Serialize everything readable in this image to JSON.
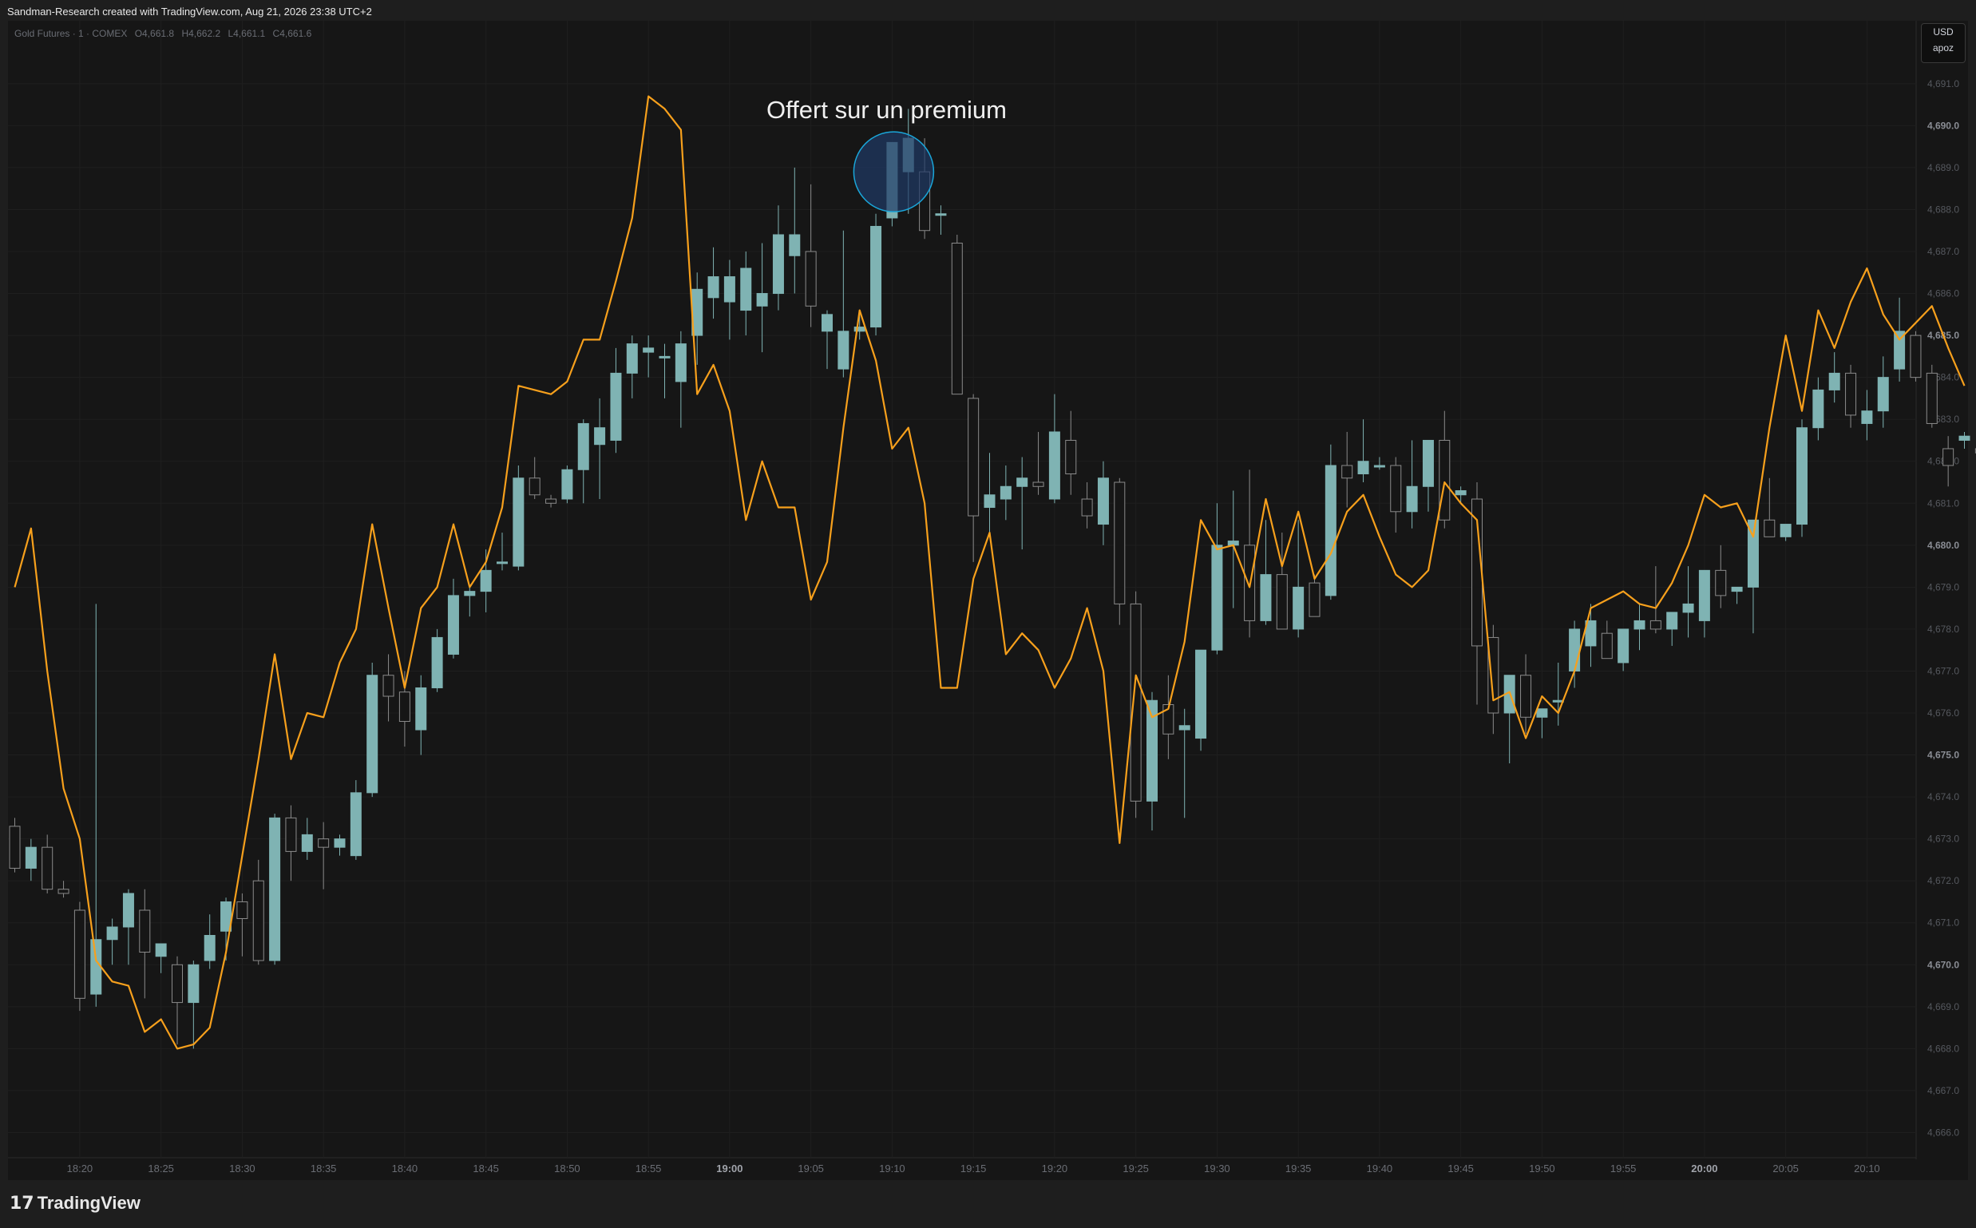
{
  "header": {
    "attribution": "Sandman-Research created with TradingView.com, Aug 21, 2026 23:38 UTC+2"
  },
  "legend": {
    "symbol": "Gold Futures · 1 · COMEX",
    "open": "O4,661.8",
    "high": "H4,662.2",
    "low": "L4,661.1",
    "close": "C4,661.6"
  },
  "currency": {
    "code": "USD",
    "label": "apoz"
  },
  "footer": {
    "brand": "TradingView"
  },
  "colors": {
    "background": "#161616",
    "candle_up": "#7fb3b3",
    "candle_down": "#161616",
    "wick": "#8a8a8a",
    "overlay_line": "#f7a01c",
    "highlight_fill": "#1f3a66",
    "highlight_stroke": "#1aa6d9"
  },
  "chart_data": {
    "type": "candlestick",
    "title": "Offert sur un premium",
    "ylim": [
      4665.4,
      4692.5
    ],
    "x_start": "18:16",
    "x_end": "20:14",
    "x_interval_minutes": 1,
    "ytick_labels": [
      "4,666.0",
      "4,667.0",
      "4,668.0",
      "4,669.0",
      "4,670.0",
      "4,671.0",
      "4,672.0",
      "4,673.0",
      "4,674.0",
      "4,675.0",
      "4,676.0",
      "4,677.0",
      "4,678.0",
      "4,679.0",
      "4,680.0",
      "4,681.0",
      "4,682.0",
      "4,683.0",
      "4,684.0",
      "4,685.0",
      "4,686.0",
      "4,687.0",
      "4,688.0",
      "4,689.0",
      "4,690.0",
      "4,691.0"
    ],
    "ytick_values": [
      4666,
      4667,
      4668,
      4669,
      4670,
      4671,
      4672,
      4673,
      4674,
      4675,
      4676,
      4677,
      4678,
      4679,
      4680,
      4681,
      4682,
      4683,
      4684,
      4685,
      4686,
      4687,
      4688,
      4689,
      4690,
      4691
    ],
    "xtick_labels": [
      "18:20",
      "18:25",
      "18:30",
      "18:35",
      "18:40",
      "18:45",
      "18:50",
      "18:55",
      "19:00",
      "19:05",
      "19:10",
      "19:15",
      "19:20",
      "19:25",
      "19:30",
      "19:35",
      "19:40",
      "19:45",
      "19:50",
      "19:55",
      "20:00",
      "20:05",
      "20:10"
    ],
    "xtick_minutes": [
      4,
      9,
      14,
      19,
      24,
      29,
      34,
      39,
      44,
      49,
      54,
      59,
      64,
      69,
      74,
      79,
      84,
      89,
      94,
      99,
      104,
      109,
      114
    ],
    "bold_xticks": [
      "19:00",
      "20:00"
    ],
    "ohlc": [
      [
        4673.3,
        4673.5,
        4672.2,
        4672.3
      ],
      [
        4672.3,
        4673.0,
        4672.0,
        4672.8
      ],
      [
        4672.8,
        4673.1,
        4671.7,
        4671.8
      ],
      [
        4671.8,
        4672.0,
        4671.6,
        4671.7
      ],
      [
        4671.3,
        4671.5,
        4668.9,
        4669.2
      ],
      [
        4669.3,
        4678.6,
        4669.0,
        4670.6
      ],
      [
        4670.6,
        4671.1,
        4670.0,
        4670.9
      ],
      [
        4670.9,
        4671.8,
        4670.0,
        4671.7
      ],
      [
        4671.3,
        4671.8,
        4669.2,
        4670.3
      ],
      [
        4670.2,
        4670.5,
        4669.8,
        4670.5
      ],
      [
        4670.0,
        4670.2,
        4668.1,
        4669.1
      ],
      [
        4669.1,
        4670.1,
        4668.0,
        4670.0
      ],
      [
        4670.1,
        4671.2,
        4669.9,
        4670.7
      ],
      [
        4670.8,
        4671.6,
        4670.1,
        4671.5
      ],
      [
        4671.5,
        4671.7,
        4670.2,
        4671.1
      ],
      [
        4672.0,
        4672.5,
        4670.0,
        4670.1
      ],
      [
        4670.1,
        4673.6,
        4670.0,
        4673.5
      ],
      [
        4673.5,
        4673.8,
        4672.0,
        4672.7
      ],
      [
        4672.7,
        4673.5,
        4672.5,
        4673.1
      ],
      [
        4673.0,
        4673.4,
        4671.8,
        4672.8
      ],
      [
        4672.8,
        4673.1,
        4672.6,
        4673.0
      ],
      [
        4672.6,
        4674.4,
        4672.5,
        4674.1
      ],
      [
        4674.1,
        4677.2,
        4674.0,
        4676.9
      ],
      [
        4676.9,
        4677.4,
        4675.8,
        4676.4
      ],
      [
        4676.5,
        4677.0,
        4675.2,
        4675.8
      ],
      [
        4675.6,
        4676.9,
        4675.0,
        4676.6
      ],
      [
        4676.6,
        4678.0,
        4676.5,
        4677.8
      ],
      [
        4677.4,
        4679.2,
        4677.3,
        4678.8
      ],
      [
        4678.8,
        4679.0,
        4678.3,
        4678.9
      ],
      [
        4678.9,
        4679.9,
        4678.4,
        4679.4
      ],
      [
        4679.6,
        4680.3,
        4679.4,
        4679.6
      ],
      [
        4679.5,
        4681.9,
        4679.4,
        4681.6
      ],
      [
        4681.6,
        4682.1,
        4681.1,
        4681.2
      ],
      [
        4681.1,
        4681.2,
        4680.9,
        4681.0
      ],
      [
        4681.1,
        4681.9,
        4681.0,
        4681.8
      ],
      [
        4681.8,
        4683.0,
        4681.0,
        4682.9
      ],
      [
        4682.4,
        4683.5,
        4681.1,
        4682.8
      ],
      [
        4682.5,
        4684.7,
        4682.2,
        4684.1
      ],
      [
        4684.1,
        4685.0,
        4683.5,
        4684.8
      ],
      [
        4684.6,
        4685.0,
        4684.0,
        4684.7
      ],
      [
        4684.5,
        4684.8,
        4683.5,
        4684.5
      ],
      [
        4683.9,
        4685.1,
        4682.8,
        4684.8
      ],
      [
        4685.0,
        4686.5,
        4684.3,
        4686.1
      ],
      [
        4685.9,
        4687.1,
        4685.4,
        4686.4
      ],
      [
        4685.8,
        4686.8,
        4684.9,
        4686.4
      ],
      [
        4685.6,
        4687.0,
        4685.0,
        4686.6
      ],
      [
        4685.7,
        4687.2,
        4684.6,
        4686.0
      ],
      [
        4686.0,
        4688.1,
        4685.6,
        4687.4
      ],
      [
        4686.9,
        4689.0,
        4686.0,
        4687.4
      ],
      [
        4687.0,
        4688.6,
        4685.2,
        4685.7
      ],
      [
        4685.1,
        4685.6,
        4684.2,
        4685.5
      ],
      [
        4684.2,
        4687.5,
        4684.0,
        4685.1
      ],
      [
        4685.1,
        4685.5,
        4684.9,
        4685.2
      ],
      [
        4685.2,
        4687.9,
        4685.0,
        4687.6
      ],
      [
        4687.8,
        4689.6,
        4687.6,
        4689.6
      ],
      [
        4688.9,
        4690.4,
        4687.9,
        4689.7
      ],
      [
        4688.9,
        4689.7,
        4687.3,
        4687.5
      ],
      [
        4687.9,
        4688.1,
        4687.4,
        4687.9
      ],
      [
        4687.2,
        4687.4,
        4683.6,
        4683.6
      ],
      [
        4683.5,
        4683.6,
        4679.6,
        4680.7
      ],
      [
        4680.9,
        4682.2,
        4680.2,
        4681.2
      ],
      [
        4681.1,
        4681.9,
        4680.6,
        4681.4
      ],
      [
        4681.4,
        4682.1,
        4679.9,
        4681.6
      ],
      [
        4681.5,
        4682.7,
        4681.2,
        4681.4
      ],
      [
        4681.1,
        4683.6,
        4681.0,
        4682.7
      ],
      [
        4682.5,
        4683.2,
        4681.2,
        4681.7
      ],
      [
        4681.1,
        4681.5,
        4680.4,
        4680.7
      ],
      [
        4680.5,
        4682.0,
        4680.0,
        4681.6
      ],
      [
        4681.5,
        4681.6,
        4678.1,
        4678.6
      ],
      [
        4678.6,
        4678.9,
        4673.5,
        4673.9
      ],
      [
        4673.9,
        4676.5,
        4673.2,
        4676.3
      ],
      [
        4676.2,
        4676.9,
        4674.9,
        4675.5
      ],
      [
        4675.6,
        4676.1,
        4673.5,
        4675.7
      ],
      [
        4675.4,
        4677.0,
        4675.1,
        4677.5
      ],
      [
        4677.5,
        4681.0,
        4677.4,
        4680.0
      ],
      [
        4680.0,
        4681.3,
        4678.5,
        4680.1
      ],
      [
        4680.0,
        4681.8,
        4677.8,
        4678.2
      ],
      [
        4678.2,
        4680.6,
        4678.1,
        4679.3
      ],
      [
        4679.3,
        4680.3,
        4678.5,
        4678.0
      ],
      [
        4678.0,
        4680.6,
        4677.8,
        4679.0
      ],
      [
        4679.1,
        4679.3,
        4678.4,
        4678.3
      ],
      [
        4678.8,
        4682.4,
        4678.7,
        4681.9
      ],
      [
        4681.9,
        4682.7,
        4680.9,
        4681.6
      ],
      [
        4681.7,
        4683.0,
        4681.5,
        4682.0
      ],
      [
        4681.9,
        4682.1,
        4681.8,
        4681.9
      ],
      [
        4681.9,
        4682.1,
        4680.3,
        4680.8
      ],
      [
        4680.8,
        4682.5,
        4680.4,
        4681.4
      ],
      [
        4681.4,
        4682.3,
        4680.8,
        4682.5
      ],
      [
        4682.5,
        4683.2,
        4680.4,
        4680.6
      ],
      [
        4681.2,
        4681.4,
        4681.0,
        4681.3
      ],
      [
        4681.1,
        4681.5,
        4676.2,
        4677.6
      ],
      [
        4677.8,
        4678.1,
        4675.5,
        4676.0
      ],
      [
        4676.0,
        4676.9,
        4674.8,
        4676.9
      ],
      [
        4676.9,
        4677.4,
        4675.5,
        4675.9
      ],
      [
        4675.9,
        4676.0,
        4675.4,
        4676.1
      ],
      [
        4676.3,
        4677.2,
        4675.7,
        4676.3
      ],
      [
        4677.0,
        4678.2,
        4676.6,
        4678.0
      ],
      [
        4677.6,
        4678.6,
        4677.1,
        4678.2
      ],
      [
        4677.9,
        4678.2,
        4677.6,
        4677.3
      ],
      [
        4677.2,
        4678.0,
        4677.0,
        4678.0
      ],
      [
        4678.0,
        4678.6,
        4677.5,
        4678.2
      ],
      [
        4678.2,
        4679.5,
        4677.9,
        4678.0
      ],
      [
        4678.0,
        4678.3,
        4677.6,
        4678.4
      ],
      [
        4678.4,
        4679.5,
        4677.8,
        4678.6
      ],
      [
        4678.2,
        4679.0,
        4677.8,
        4679.4
      ],
      [
        4679.4,
        4680.0,
        4678.5,
        4678.8
      ],
      [
        4678.9,
        4678.9,
        4678.6,
        4679.0
      ],
      [
        4679.0,
        4679.3,
        4677.9,
        4680.6
      ],
      [
        4680.6,
        4681.6,
        4680.2,
        4680.2
      ],
      [
        4680.2,
        4680.5,
        4680.1,
        4680.5
      ],
      [
        4680.5,
        4683.0,
        4680.2,
        4682.8
      ],
      [
        4682.8,
        4684.0,
        4682.5,
        4683.7
      ],
      [
        4683.7,
        4684.6,
        4683.4,
        4684.1
      ],
      [
        4684.1,
        4684.3,
        4682.8,
        4683.1
      ],
      [
        4682.9,
        4683.7,
        4682.5,
        4683.2
      ],
      [
        4683.2,
        4684.5,
        4682.8,
        4684.0
      ],
      [
        4684.2,
        4685.9,
        4683.9,
        4685.1
      ],
      [
        4685.0,
        4685.1,
        4683.9,
        4684.0
      ],
      [
        4684.1,
        4684.3,
        4682.8,
        4682.9
      ],
      [
        4682.3,
        4682.6,
        4681.4,
        4681.9
      ],
      [
        4682.5,
        4682.7,
        4682.3,
        4682.6
      ],
      [
        4682.3,
        4682.5,
        4682.1,
        4682.2
      ]
    ],
    "overlay_series": {
      "color": "#f7a01c",
      "values": [
        4679.0,
        4680.4,
        4677.0,
        4674.2,
        4673.0,
        4670.1,
        4669.6,
        4669.5,
        4668.4,
        4668.7,
        4668.0,
        4668.1,
        4668.5,
        4670.3,
        4672.6,
        4674.9,
        4677.4,
        4674.9,
        4676.0,
        4675.9,
        4677.2,
        4678.0,
        4680.5,
        4678.5,
        4676.6,
        4678.5,
        4679.0,
        4680.5,
        4679.0,
        4679.6,
        4680.9,
        4683.8,
        4683.7,
        4683.6,
        4683.9,
        4684.9,
        4684.9,
        4686.3,
        4687.8,
        4690.7,
        4690.4,
        4689.9,
        4683.6,
        4684.3,
        4683.2,
        4680.6,
        4682.0,
        4680.9,
        4680.9,
        4678.7,
        4679.6,
        4682.8,
        4685.6,
        4684.4,
        4682.3,
        4682.8,
        4681.0,
        4676.6,
        4676.6,
        4679.2,
        4680.3,
        4677.4,
        4677.9,
        4677.5,
        4676.6,
        4677.3,
        4678.5,
        4677.0,
        4672.9,
        4676.9,
        4675.9,
        4676.1,
        4677.7,
        4680.6,
        4679.9,
        4680.0,
        4679.0,
        4681.1,
        4679.5,
        4680.8,
        4679.2,
        4679.8,
        4680.8,
        4681.2,
        4680.2,
        4679.3,
        4679.0,
        4679.4,
        4681.5,
        4681.0,
        4680.6,
        4676.3,
        4676.5,
        4675.4,
        4676.4,
        4676.0,
        4677.0,
        4678.5,
        4678.7,
        4678.9,
        4678.6,
        4678.5,
        4679.1,
        4680.0,
        4681.2,
        4680.9,
        4681.0,
        4680.2,
        4682.8,
        4685.0,
        4683.2,
        4685.6,
        4684.7,
        4685.8,
        4686.6,
        4685.5,
        4684.9,
        4685.3,
        4685.7,
        4684.7,
        4683.8
      ]
    },
    "annotations": [
      {
        "type": "circle",
        "minute": 54,
        "price": 4688.9,
        "note": "Offert sur un premium"
      }
    ],
    "grid": true,
    "legend_position": "top-left"
  }
}
